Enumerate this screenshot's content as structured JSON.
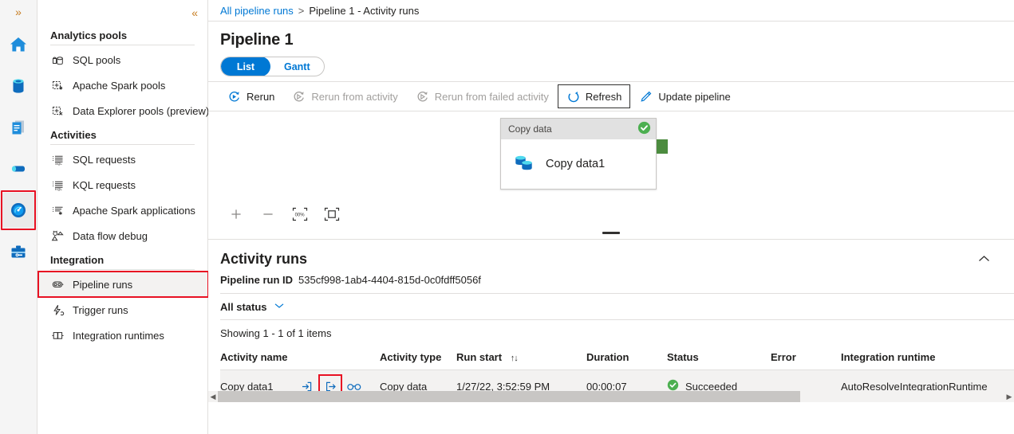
{
  "rail": {
    "expand_label": "»",
    "items": [
      {
        "name": "home-icon",
        "title": "Home"
      },
      {
        "name": "data-icon",
        "title": "Data"
      },
      {
        "name": "develop-icon",
        "title": "Develop"
      },
      {
        "name": "integrate-icon",
        "title": "Integrate"
      },
      {
        "name": "monitor-icon",
        "title": "Monitor",
        "selected": true
      },
      {
        "name": "manage-icon",
        "title": "Manage"
      }
    ]
  },
  "nav": {
    "collapse_label": "«",
    "groups": [
      {
        "title": "Analytics pools",
        "items": [
          {
            "label": "SQL pools",
            "icon": "sql-pool-icon"
          },
          {
            "label": "Apache Spark pools",
            "icon": "spark-pool-icon"
          },
          {
            "label": "Data Explorer pools (preview)",
            "icon": "data-explorer-pool-icon"
          }
        ]
      },
      {
        "title": "Activities",
        "items": [
          {
            "label": "SQL requests",
            "icon": "sql-request-icon"
          },
          {
            "label": "KQL requests",
            "icon": "kql-request-icon"
          },
          {
            "label": "Apache Spark applications",
            "icon": "spark-application-icon"
          },
          {
            "label": "Data flow debug",
            "icon": "data-flow-debug-icon"
          }
        ]
      },
      {
        "title": "Integration",
        "items": [
          {
            "label": "Pipeline runs",
            "icon": "pipeline-runs-icon",
            "selected": true,
            "highlighted": true
          },
          {
            "label": "Trigger runs",
            "icon": "trigger-runs-icon"
          },
          {
            "label": "Integration runtimes",
            "icon": "integration-runtimes-icon"
          }
        ]
      }
    ]
  },
  "breadcrumb": {
    "root": "All pipeline runs",
    "separator": ">",
    "current": "Pipeline 1 - Activity runs"
  },
  "page": {
    "title": "Pipeline 1"
  },
  "view_toggle": {
    "list": "List",
    "gantt": "Gantt"
  },
  "toolbar": {
    "rerun": "Rerun",
    "rerun_from_activity": "Rerun from activity",
    "rerun_from_failed_activity": "Rerun from failed activity",
    "refresh": "Refresh",
    "update_pipeline": "Update pipeline"
  },
  "canvas": {
    "node": {
      "header": "Copy data",
      "label": "Copy data1",
      "status": "succeeded"
    },
    "tools": {
      "zoom_in": "+",
      "zoom_out": "—",
      "zoom_level": "100%",
      "fit_to_screen": "Fit to screen"
    }
  },
  "activity_runs": {
    "title": "Activity runs",
    "collapse_caret": "⌃",
    "run_id_label": "Pipeline run ID",
    "run_id_value": "535cf998-1ab4-4404-815d-0c0fdff5056f",
    "status_filter": "All status",
    "filter_caret": "∨",
    "showing": "Showing 1 - 1 of 1 items",
    "columns": [
      "Activity name",
      "Activity type",
      "Run start",
      "Duration",
      "Status",
      "Error",
      "Integration runtime"
    ],
    "sort_indicator": "↑↓",
    "rows": [
      {
        "activity_name": "Copy data1",
        "activity_type": "Copy data",
        "run_start": "1/27/22, 3:52:59 PM",
        "duration": "00:00:07",
        "status": "Succeeded",
        "error": "",
        "integration_runtime": "AutoResolveIntegrationRuntime"
      }
    ],
    "scroll_left": "◀",
    "scroll_right": "▶"
  },
  "colors": {
    "accent": "#0078d4",
    "success": "#4caf50",
    "node_tab": "#4c8c3f",
    "highlight_box": "#e81123"
  }
}
